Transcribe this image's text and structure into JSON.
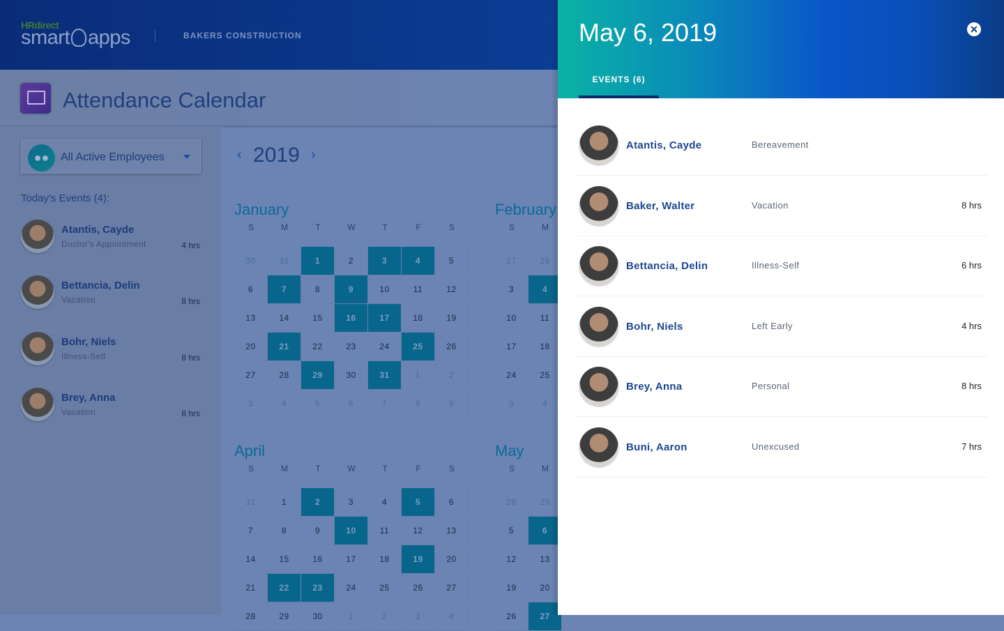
{
  "header": {
    "logo_brand": "HRdirect",
    "logo_text_left": "smart",
    "logo_text_right": "apps",
    "company": "BAKERS CONSTRUCTION"
  },
  "page": {
    "title": "Attendance Calendar"
  },
  "filter": {
    "label": "All Active Employees",
    "icon": "people-icon"
  },
  "today": {
    "heading": "Today's Events (4):",
    "items": [
      {
        "name": "Atantis, Cayde",
        "type": "Doctor's Appointment",
        "hours": "4 hrs"
      },
      {
        "name": "Bettancia, Delin",
        "type": "Vacation",
        "hours": "8 hrs"
      },
      {
        "name": "Bohr, Niels",
        "type": "Illness-Self",
        "hours": "8 hrs"
      },
      {
        "name": "Brey, Anna",
        "type": "Vacation",
        "hours": "8 hrs"
      }
    ]
  },
  "calendar": {
    "year": "2019",
    "day_headers": [
      "S",
      "M",
      "T",
      "W",
      "T",
      "F",
      "S"
    ],
    "months": [
      {
        "name": "January",
        "weeks": [
          [
            30,
            31,
            1,
            2,
            3,
            4,
            5
          ],
          [
            6,
            7,
            8,
            9,
            10,
            11,
            12
          ],
          [
            13,
            14,
            15,
            16,
            17,
            18,
            19
          ],
          [
            20,
            21,
            22,
            23,
            24,
            25,
            26
          ],
          [
            27,
            28,
            29,
            30,
            31,
            1,
            2
          ],
          [
            3,
            4,
            5,
            6,
            7,
            8,
            9
          ]
        ],
        "events": [
          1,
          3,
          4,
          7,
          9,
          16,
          17,
          21,
          25,
          29,
          31
        ]
      },
      {
        "name": "February",
        "weeks": [
          [
            27,
            28
          ],
          [
            3,
            4
          ],
          [
            10,
            11
          ],
          [
            17,
            18
          ],
          [
            24,
            25
          ],
          [
            3,
            4
          ]
        ],
        "events": [
          4
        ]
      },
      {
        "name": "April",
        "weeks": [
          [
            31,
            1,
            2,
            3,
            4,
            5,
            6
          ],
          [
            7,
            8,
            9,
            10,
            11,
            12,
            13
          ],
          [
            14,
            15,
            16,
            17,
            18,
            19,
            20
          ],
          [
            21,
            22,
            23,
            24,
            25,
            26,
            27
          ],
          [
            28,
            29,
            30,
            1,
            2,
            3,
            4
          ]
        ],
        "events": [
          2,
          5,
          10,
          19,
          22,
          23
        ]
      },
      {
        "name": "May",
        "weeks": [
          [
            28,
            29
          ],
          [
            5,
            6
          ],
          [
            12,
            13
          ],
          [
            19,
            20
          ],
          [
            26,
            27
          ]
        ],
        "events": [
          6,
          27
        ]
      }
    ]
  },
  "panel": {
    "date": "May 6, 2019",
    "tab": "EVENTS (6)",
    "close_icon": "close-circle-icon",
    "events": [
      {
        "name": "Atantis, Cayde",
        "type": "Bereavement",
        "hours": ""
      },
      {
        "name": "Baker, Walter",
        "type": "Vacation",
        "hours": "8 hrs"
      },
      {
        "name": "Bettancia, Delin",
        "type": "Illness-Self",
        "hours": "6 hrs"
      },
      {
        "name": "Bohr, Niels",
        "type": "Left Early",
        "hours": "4 hrs"
      },
      {
        "name": "Brey, Anna",
        "type": "Personal",
        "hours": "8 hrs"
      },
      {
        "name": "Buni, Aaron",
        "type": "Unexcused",
        "hours": "7 hrs"
      }
    ]
  },
  "colors": {
    "event_day": "#08668c",
    "accent": "#1d4690",
    "header_teal": "#0ab2a5",
    "header_blue": "#0a56c9"
  }
}
